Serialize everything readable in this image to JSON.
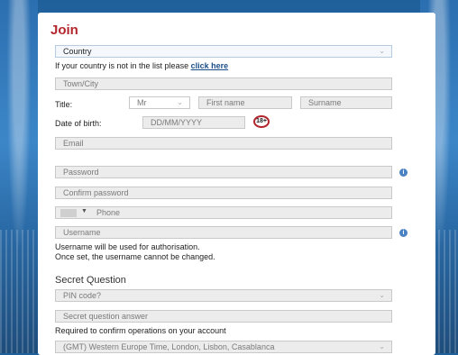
{
  "form": {
    "title": "Join",
    "country": {
      "value": "Country"
    },
    "country_note": "If your country is not in the list please",
    "country_link": "click here",
    "town_placeholder": "Town/City",
    "title_label": "Title:",
    "title_value": "Mr",
    "first_name_placeholder": "First name",
    "surname_placeholder": "Surname",
    "dob_label": "Date of birth:",
    "dob_placeholder": "DD/MM/YYYY",
    "age_badge": "18+",
    "email_placeholder": "Email",
    "password_placeholder": "Password",
    "confirm_password_placeholder": "Confirm password",
    "phone_placeholder": "Phone",
    "username_placeholder": "Username",
    "username_note_1": "Username will be used for authorisation.",
    "username_note_2": "Once set, the username cannot be changed.",
    "secret_heading": "Secret Question",
    "secret_question_value": "PIN code?",
    "secret_answer_placeholder": "Secret question answer",
    "secret_note": "Required to confirm operations on your account",
    "timezone_value": "(GMT) Western Europe Time, London, Lisbon, Casablanca"
  },
  "icons": {
    "info": "i",
    "chevron": "⌄",
    "caret": "▼"
  },
  "colors": {
    "accent": "#b3262d",
    "link": "#1a4e8a",
    "info": "#4a82c4"
  }
}
